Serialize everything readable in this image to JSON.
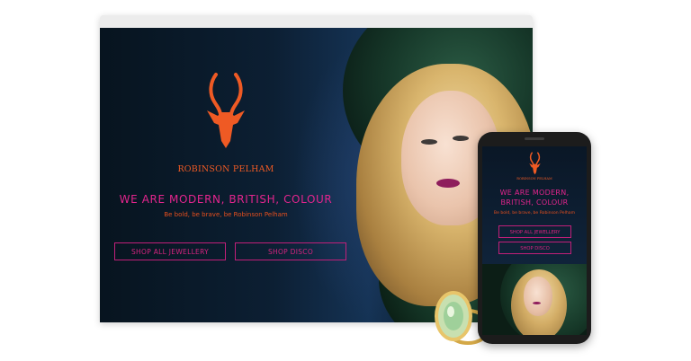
{
  "desktop": {
    "brand_name": "ROBINSON PELHAM",
    "headline": "WE ARE MODERN, BRITISH, COLOUR",
    "tagline": "Be bold, be brave, be Robinson Pelham",
    "buttons": {
      "shop_all": "SHOP ALL JEWELLERY",
      "shop_disco": "SHOP DISCO"
    }
  },
  "mobile": {
    "brand_name": "ROBINSON PELHAM",
    "headline": "WE ARE MODERN, BRITISH, COLOUR",
    "tagline": "Be bold, be brave, be Robinson Pelham",
    "buttons": {
      "shop_all": "SHOP ALL JEWELLERY",
      "shop_disco": "SHOP DISCO"
    }
  },
  "colors": {
    "brand_orange": "#ef5a24",
    "accent_magenta": "#e3258d",
    "background_navy": "#0c1f33"
  },
  "icons": {
    "logo": "antelope-head-logo"
  }
}
